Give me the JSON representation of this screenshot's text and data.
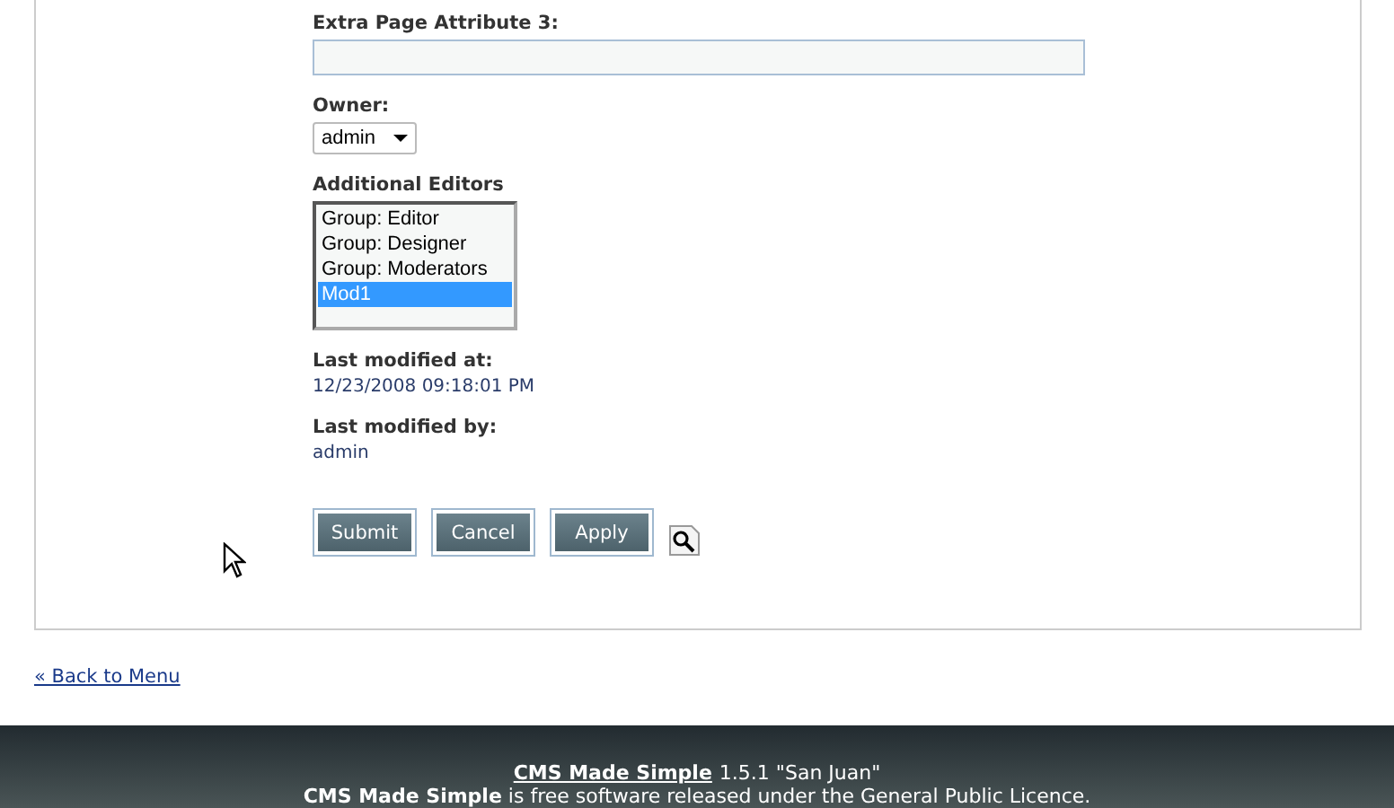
{
  "form": {
    "fields": [
      {
        "kind": "text",
        "label": "Extra Page Attribute 3:"
      },
      {
        "kind": "select",
        "label": "Owner:",
        "value": "admin"
      },
      {
        "kind": "multiselect",
        "label": "Additional Editors",
        "options": [
          {
            "label": "Group: Editor",
            "selected": false
          },
          {
            "label": "Group: Designer",
            "selected": false
          },
          {
            "label": "Group: Moderators",
            "selected": false
          },
          {
            "label": "Mod1",
            "selected": true
          }
        ]
      },
      {
        "kind": "info",
        "label": "Last modified at:",
        "value": "12/23/2008 09:18:01 PM"
      },
      {
        "kind": "info",
        "label": "Last modified by:",
        "value": "admin"
      }
    ],
    "buttons": [
      "Submit",
      "Cancel",
      "Apply"
    ]
  },
  "back_link": "« Back to Menu",
  "footer": {
    "link": "CMS Made Simple",
    "version": "1.5.1 \"San Juan\"",
    "licence": "**CMS Made Simple** is free software released under the General Public Licence."
  }
}
